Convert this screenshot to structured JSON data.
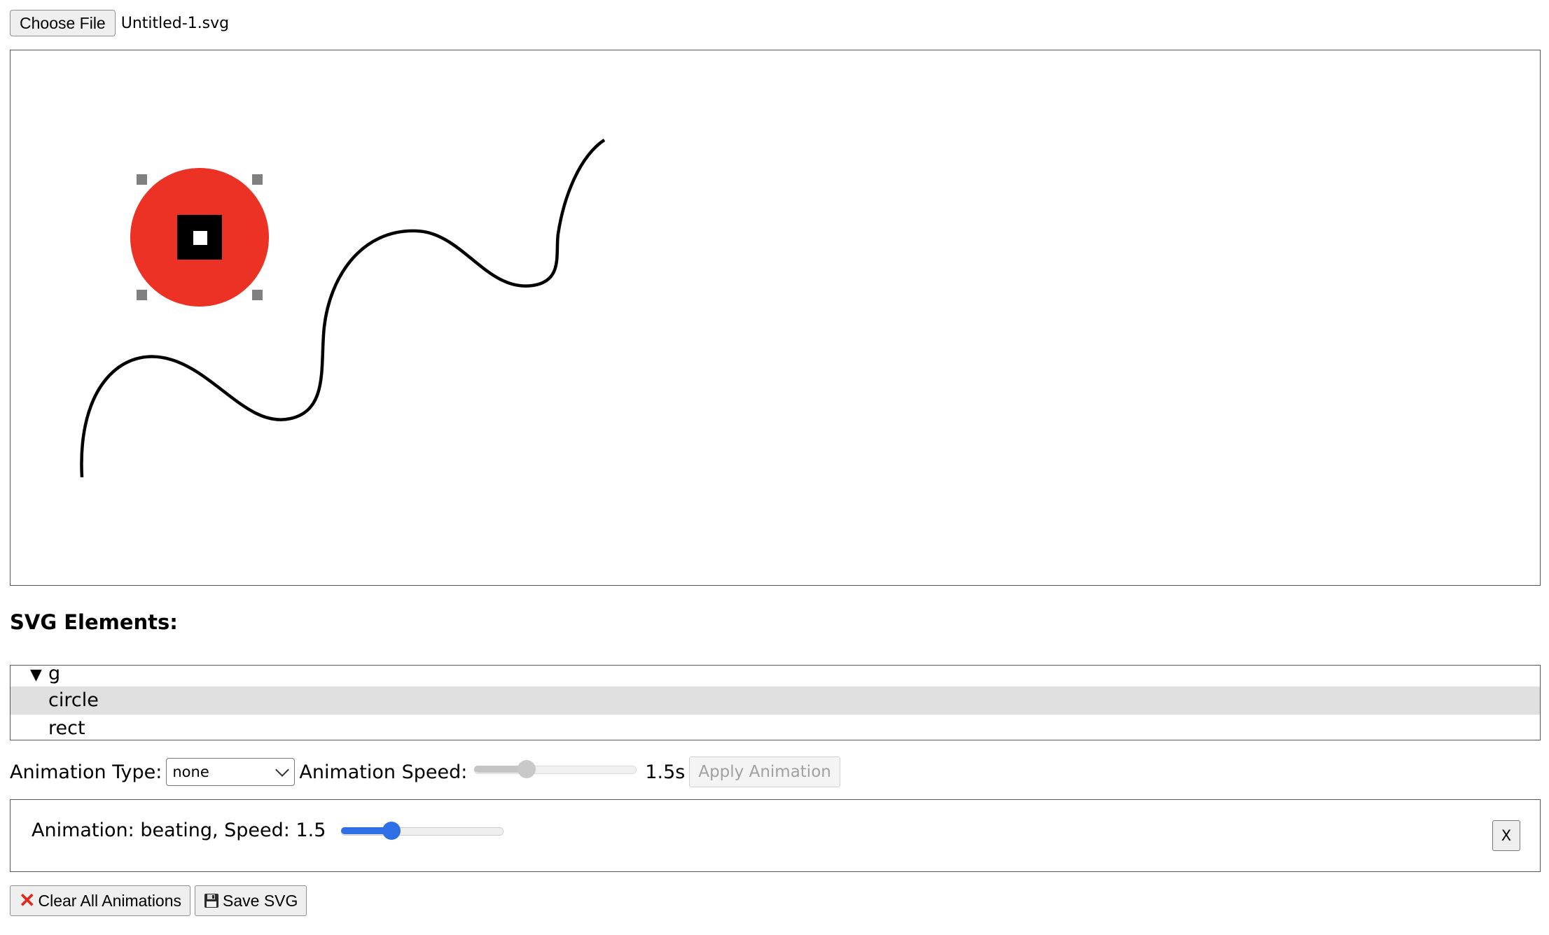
{
  "file_input": {
    "button_label": "Choose File",
    "file_name": "Untitled-1.svg"
  },
  "canvas": {
    "circle_fill": "#ec3224",
    "rect_fill": "#000000",
    "path_stroke": "#000000",
    "handle_color": "#808080"
  },
  "elements_panel": {
    "title": "SVG Elements:",
    "tree": [
      {
        "label": "g",
        "toggle": "▼",
        "selected": false
      },
      {
        "label": "circle",
        "selected": true
      },
      {
        "label": "rect",
        "selected": false
      }
    ]
  },
  "controls": {
    "animation_type_label": "Animation Type:",
    "animation_type_value": "none",
    "animation_speed_label": "Animation Speed:",
    "speed_fraction": 0.32,
    "speed_value": "1.5s",
    "apply_label": "Apply Animation"
  },
  "animations": [
    {
      "text": "Animation: beating, Speed: 1.5",
      "slider_fraction": 0.31,
      "remove_label": "X"
    }
  ],
  "footer": {
    "clear_label": "Clear All Animations",
    "save_label": "Save SVG"
  },
  "colors": {
    "accent": "#2f6fe6",
    "selected_row": "#e0e0e0",
    "clear_icon": "#e0281c"
  }
}
